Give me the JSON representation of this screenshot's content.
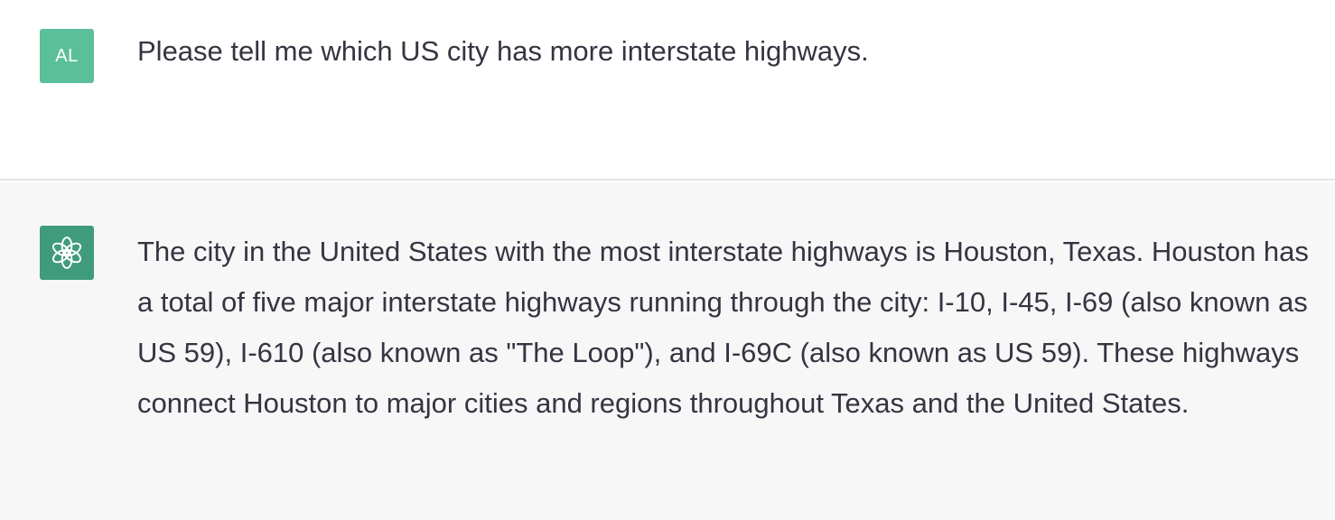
{
  "user_message": {
    "avatar_initials": "AL",
    "text": "Please tell me which US city has more interstate highways."
  },
  "assistant_message": {
    "avatar_icon": "openai-logo-icon",
    "text": "The city in the United States with the most interstate highways is Houston, Texas. Houston has a total of five major interstate highways running through the city: I-10, I-45, I-69 (also known as US 59), I-610 (also known as \"The Loop\"), and I-69C (also known as US 59). These highways connect Houston to major cities and regions throughout Texas and the United States."
  },
  "colors": {
    "user_avatar_bg": "#5bbf9a",
    "assistant_avatar_bg": "#3f9b7c",
    "assistant_row_bg": "#f7f7f8",
    "text": "#343541"
  }
}
